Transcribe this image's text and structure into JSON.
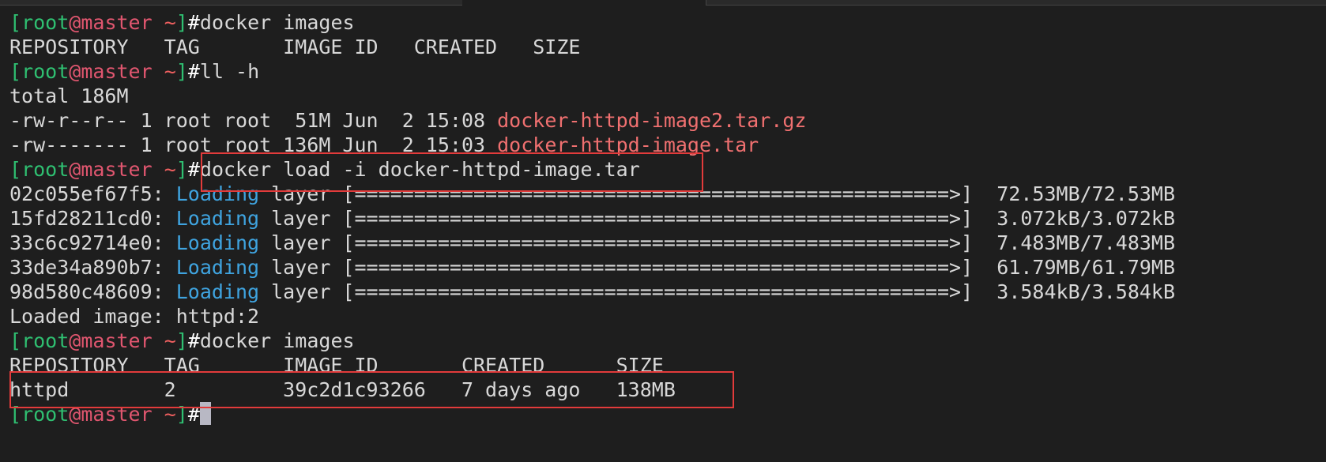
{
  "prompt": {
    "open": "[",
    "user": "root",
    "at": "@",
    "host": "master",
    "dir": " ~",
    "close": "]",
    "hash": "#"
  },
  "lines": {
    "l1_cmd": "docker images",
    "l2": "REPOSITORY   TAG       IMAGE ID   CREATED   SIZE",
    "l3_cmd": "ll -h",
    "l4": "total 186M",
    "l5_perm": "-rw-r--r-- 1 root root  51M Jun  2 15:08 ",
    "l5_file": "docker-httpd-image2.tar.gz",
    "l6_perm": "-rw------- 1 root root 136M Jun  2 15:03 ",
    "l6_file": "docker-httpd-image.tar",
    "l7_cmd": "docker load -i docker-httpd-image.tar",
    "layers": [
      {
        "id": "02c055ef67f5: ",
        "word": "Loading",
        "bar": " layer [==================================================>]  ",
        "size": "72.53MB/72.53MB"
      },
      {
        "id": "15fd28211cd0: ",
        "word": "Loading",
        "bar": " layer [==================================================>]  ",
        "size": "3.072kB/3.072kB"
      },
      {
        "id": "33c6c92714e0: ",
        "word": "Loading",
        "bar": " layer [==================================================>]  ",
        "size": "7.483MB/7.483MB"
      },
      {
        "id": "33de34a890b7: ",
        "word": "Loading",
        "bar": " layer [==================================================>]  ",
        "size": "61.79MB/61.79MB"
      },
      {
        "id": "98d580c48609: ",
        "word": "Loading",
        "bar": " layer [==================================================>]  ",
        "size": "3.584kB/3.584kB"
      }
    ],
    "l13": "Loaded image: httpd:2",
    "l14_cmd": "docker images",
    "l15": "REPOSITORY   TAG       IMAGE ID       CREATED      SIZE",
    "l16": "httpd        2         39c2d1c93266   7 days ago   138MB"
  },
  "colors": {
    "background": "#1e1e1e",
    "prompt_bracket": "#2fbf71",
    "prompt_host": "#e0566f",
    "filename": "#f07070",
    "loading": "#3fa4e0",
    "highlight_box": "#e23b3b"
  }
}
